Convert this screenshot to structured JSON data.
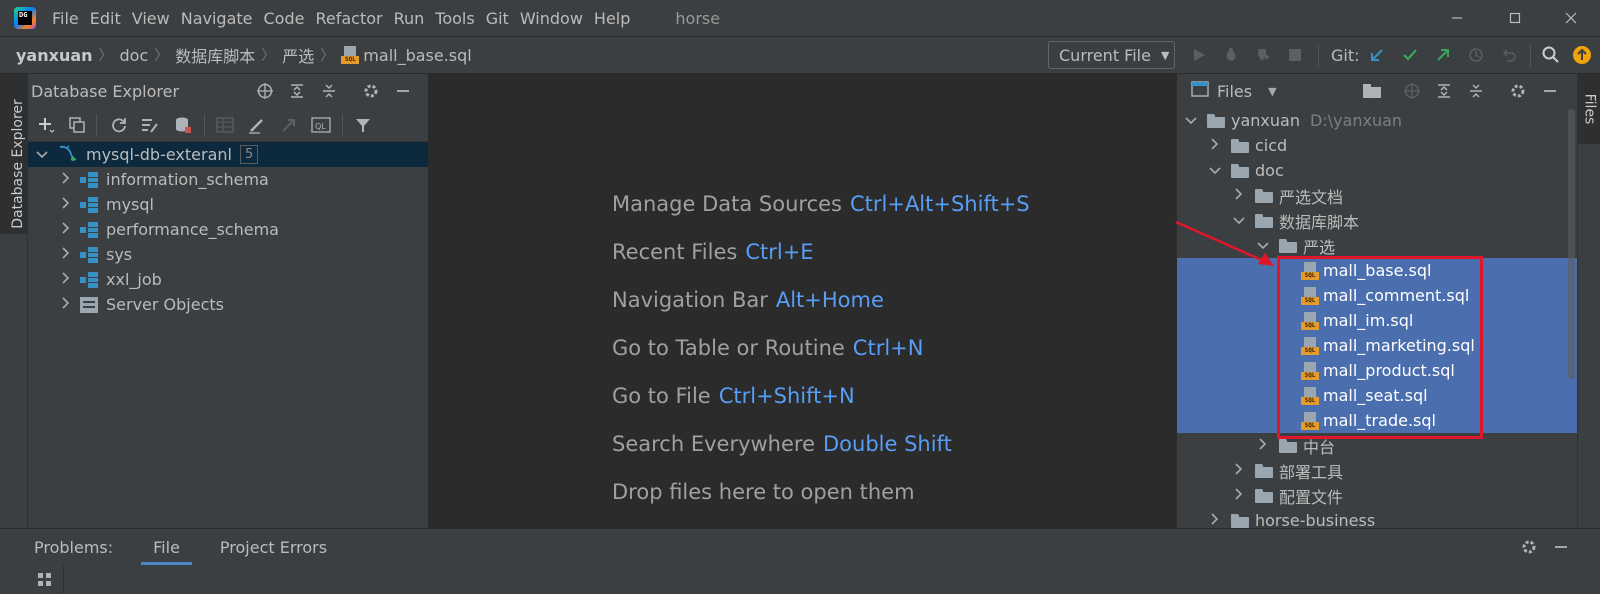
{
  "menubar": {
    "items": [
      "File",
      "Edit",
      "View",
      "Navigate",
      "Code",
      "Refactor",
      "Run",
      "Tools",
      "Git",
      "Window",
      "Help"
    ],
    "project": "horse",
    "logo_text": "DG"
  },
  "navbar": {
    "crumbs": [
      "yanxuan",
      "doc",
      "数据库脚本",
      "严选",
      "mall_base.sql"
    ],
    "run_config": "Current File",
    "git_label": "Git:"
  },
  "left_strip": {
    "label": "Database Explorer"
  },
  "right_strip": {
    "label": "Files"
  },
  "db_panel": {
    "title": "Database Explorer",
    "datasource": {
      "name": "mysql-db-exteranl",
      "count": "5"
    },
    "schemas": [
      "information_schema",
      "mysql",
      "performance_schema",
      "sys",
      "xxl_job"
    ],
    "server_objects": "Server Objects"
  },
  "editor": {
    "hints": [
      {
        "label": "Manage Data Sources",
        "key": "Ctrl+Alt+Shift+S"
      },
      {
        "label": "Recent Files",
        "key": "Ctrl+E"
      },
      {
        "label": "Navigation Bar",
        "key": "Alt+Home"
      },
      {
        "label": "Go to Table or Routine",
        "key": "Ctrl+N"
      },
      {
        "label": "Go to File",
        "key": "Ctrl+Shift+N"
      },
      {
        "label": "Search Everywhere",
        "key": "Double Shift"
      }
    ],
    "drop_text": "Drop files here to open them"
  },
  "files_panel": {
    "title": "Files",
    "root": {
      "name": "yanxuan",
      "path": "D:\\yanxuan"
    },
    "items": {
      "cicd": "cicd",
      "doc": "doc",
      "yanxuan_docs": "严选文档",
      "db_scripts": "数据库脚本",
      "yanxuan": "严选",
      "middle": "中台",
      "deploy_tools": "部署工具",
      "config_files": "配置文件",
      "horse_business": "horse-business"
    },
    "sql_files": [
      "mall_base.sql",
      "mall_comment.sql",
      "mall_im.sql",
      "mall_marketing.sql",
      "mall_product.sql",
      "mall_seat.sql",
      "mall_trade.sql"
    ],
    "sql_badge": "SQL"
  },
  "bottom": {
    "tabs": [
      "Problems:",
      "File",
      "Project Errors"
    ]
  },
  "colors": {
    "accent": "#4b6eaf",
    "shortcut": "#589df6",
    "annotation": "#e0162b",
    "git_green": "#3ba55d",
    "git_blue": "#3592c4"
  }
}
